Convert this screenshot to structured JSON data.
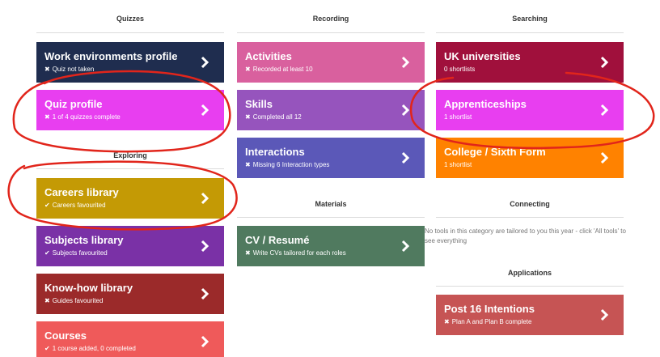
{
  "colors": {
    "work_env": "#1f2d4f",
    "quiz": "#e83ef0",
    "careers": "#c49a05",
    "subjects": "#7a31a6",
    "knowhow": "#9b2a2a",
    "courses": "#ef5a5a",
    "activities": "#d9609e",
    "skills": "#9654bd",
    "interactions": "#5b58b8",
    "cv": "#507a5f",
    "uk_uni": "#a0103c",
    "apprenticeships": "#e83ef0",
    "college": "#ff8200",
    "post16": "#c65454",
    "annotation": "#e1251b"
  },
  "quizzes": {
    "heading": "Quizzes",
    "work": {
      "title": "Work environments profile",
      "mark": "✖",
      "status": "Quiz not taken"
    },
    "quiz": {
      "title": "Quiz profile",
      "mark": "✖",
      "status": "1 of 4 quizzes complete"
    }
  },
  "exploring": {
    "heading": "Exploring",
    "careers": {
      "title": "Careers library",
      "mark": "✔",
      "status": "Careers favourited"
    },
    "subjects": {
      "title": "Subjects library",
      "mark": "✔",
      "status": "Subjects favourited"
    },
    "knowhow": {
      "title": "Know-how library",
      "mark": "✖",
      "status": "Guides favourited"
    },
    "courses": {
      "title": "Courses",
      "mark": "✔",
      "status": "1 course added, 0 completed"
    }
  },
  "recording": {
    "heading": "Recording",
    "activities": {
      "title": "Activities",
      "mark": "✖",
      "status": "Recorded at least 10"
    },
    "skills": {
      "title": "Skills",
      "mark": "✖",
      "status": "Completed all 12"
    },
    "interactions": {
      "title": "Interactions",
      "mark": "✖",
      "status": "Missing 6 Interaction types"
    }
  },
  "materials": {
    "heading": "Materials",
    "cv": {
      "title": "CV / Resumé",
      "mark": "✖",
      "status": "Write CVs tailored for each roles"
    }
  },
  "searching": {
    "heading": "Searching",
    "uk_uni": {
      "title": "UK universities",
      "status": "0 shortlists"
    },
    "apprenticeships": {
      "title": "Apprenticeships",
      "status": "1 shortlist"
    },
    "college": {
      "title": "College / Sixth Form",
      "status": "1 shortlist"
    }
  },
  "connecting": {
    "heading": "Connecting",
    "note": "No tools in this category are tailored to you this year - click 'All tools' to see everything"
  },
  "applications": {
    "heading": "Applications",
    "post16": {
      "title": "Post 16 Intentions",
      "mark": "✖",
      "status": "Plan A and Plan B complete"
    }
  }
}
